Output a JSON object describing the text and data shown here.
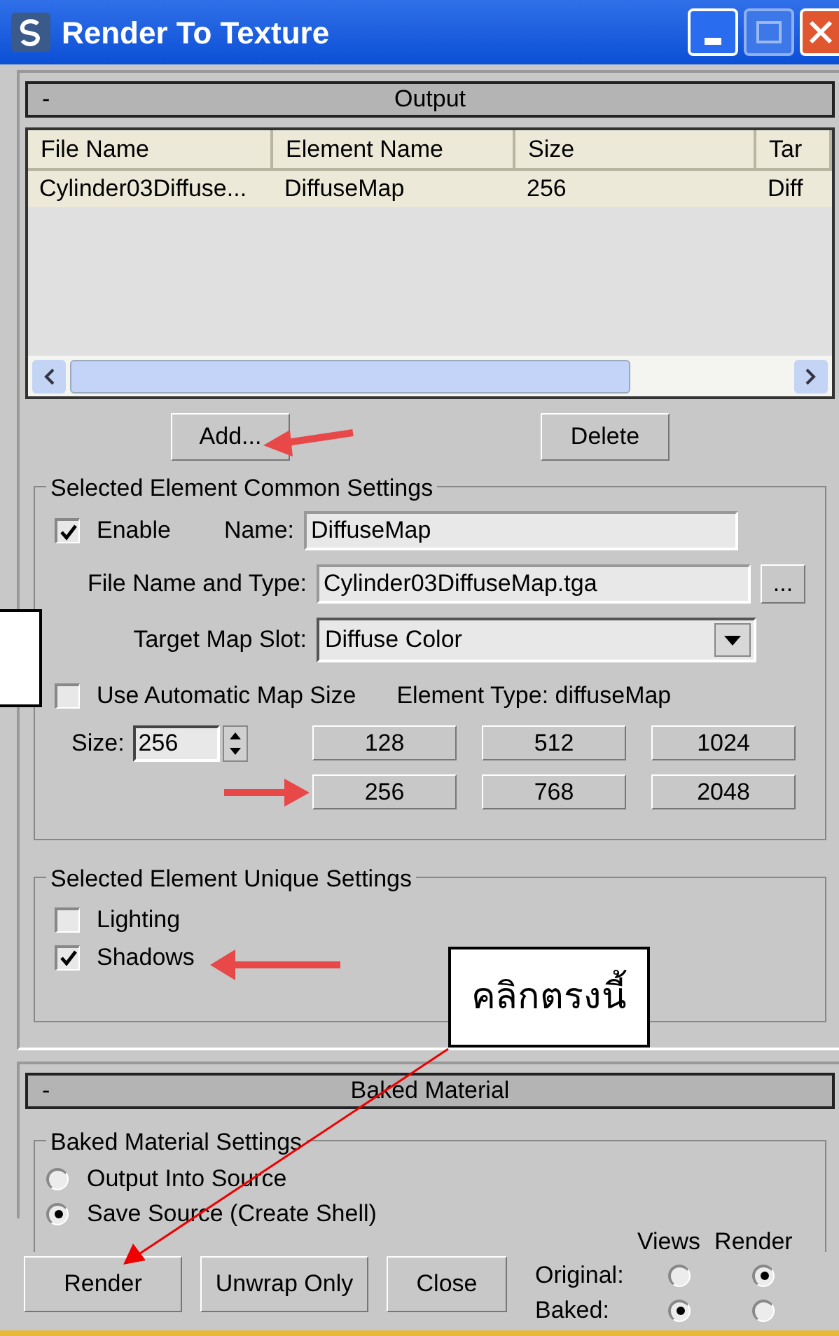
{
  "window": {
    "title": "Render To Texture"
  },
  "output_rollout": {
    "toggle": "-",
    "title": "Output",
    "table": {
      "columns": [
        "File Name",
        "Element Name",
        "Size",
        "Tar"
      ],
      "rows": [
        {
          "cells": [
            "Cylinder03Diffuse...",
            "DiffuseMap",
            "256",
            "Diff"
          ],
          "selected": true
        }
      ]
    },
    "add_button": "Add...",
    "delete_button": "Delete",
    "common_settings": {
      "title": "Selected Element Common Settings",
      "enable": {
        "label": "Enable",
        "checked": true
      },
      "name": {
        "label": "Name:",
        "value": "DiffuseMap"
      },
      "file_name": {
        "label": "File Name and Type:",
        "value": "Cylinder03DiffuseMap.tga",
        "browse": "..."
      },
      "target_map_slot": {
        "label": "Target Map Slot:",
        "value": "Diffuse Color"
      },
      "automatic_size": {
        "label": "Use Automatic Map Size",
        "checked": false
      },
      "element_type": "Element Type: diffuseMap",
      "size": {
        "label": "Size:",
        "value": "256"
      },
      "size_buttons": [
        "128",
        "512",
        "1024",
        "256",
        "768",
        "2048"
      ]
    },
    "unique_settings": {
      "title": "Selected Element Unique Settings",
      "options": [
        {
          "label": "Lighting",
          "checked": false
        },
        {
          "label": "Shadows",
          "checked": true
        }
      ]
    }
  },
  "baked_rollout": {
    "toggle": "-",
    "title": "Baked Material",
    "group": "Baked Material Settings",
    "options": [
      {
        "label": "Output Into Source",
        "selected": false
      },
      {
        "label": "Save Source (Create Shell)",
        "selected": true
      }
    ]
  },
  "bottom_bar": {
    "buttons": [
      "Render",
      "Unwrap Only",
      "Close"
    ],
    "headers": [
      "Views",
      "Render"
    ],
    "rows": [
      {
        "label": "Original:",
        "views": false,
        "render": true
      },
      {
        "label": "Baked:",
        "views": true,
        "render": false
      }
    ]
  },
  "annotations": {
    "callout": "คลิกตรงนี้"
  }
}
